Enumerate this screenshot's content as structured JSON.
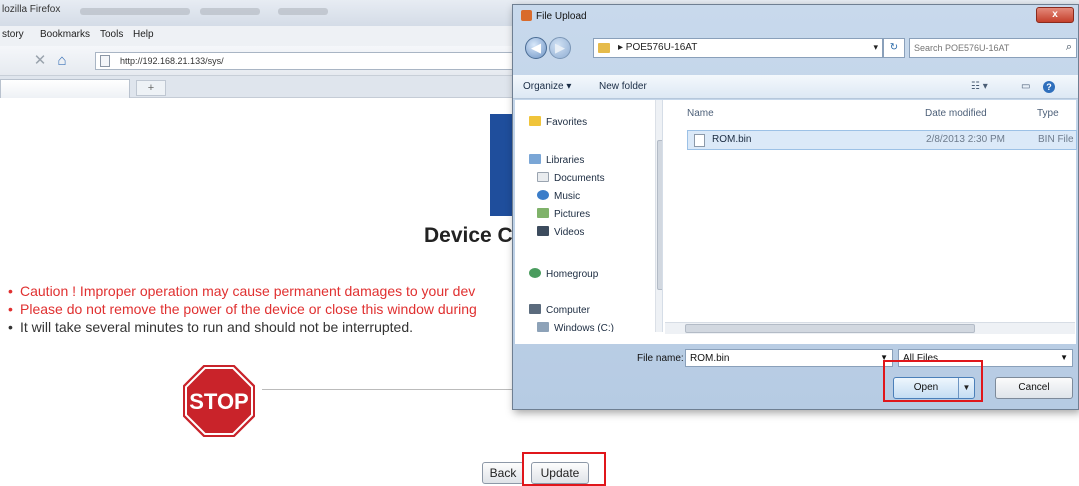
{
  "browser": {
    "window_title": "lozilla Firefox",
    "menu": {
      "history": "story",
      "bookmarks": "Bookmarks",
      "tools": "Tools",
      "help": "Help"
    },
    "url": "http://192.168.21.133/sys/",
    "new_tab": "+"
  },
  "page": {
    "title": "Device C",
    "cautions": [
      "Caution !  Improper operation may cause permanent damages to your dev",
      "Please do not remove the power of the device or close this window during",
      "It will take several minutes to run and should not be interrupted."
    ],
    "stop_sign": "STOP",
    "back_label": "Back",
    "update_label": "Update"
  },
  "dialog": {
    "title": "File Upload",
    "close": "x",
    "breadcrumb": "▸  POE576U-16AT",
    "search_placeholder": "Search POE576U-16AT",
    "toolbar": {
      "organize": "Organize ▾",
      "new_folder": "New folder"
    },
    "nav": {
      "favorites": "Favorites",
      "libraries": "Libraries",
      "documents": "Documents",
      "music": "Music",
      "pictures": "Pictures",
      "videos": "Videos",
      "homegroup": "Homegroup",
      "computer": "Computer",
      "windows": "Windows (C:)"
    },
    "columns": {
      "name": "Name",
      "date": "Date modified",
      "type": "Type"
    },
    "files": [
      {
        "name": "ROM.bin",
        "date": "2/8/2013 2:30 PM",
        "type": "BIN File"
      }
    ],
    "filename_label": "File name:",
    "filename_value": "ROM.bin",
    "filetype_value": "All Files",
    "open_label": "Open",
    "cancel_label": "Cancel"
  },
  "colors": {
    "accent_red": "#e0161b",
    "caution_text": "#e03030",
    "logo_blue": "#1f4e9c"
  }
}
